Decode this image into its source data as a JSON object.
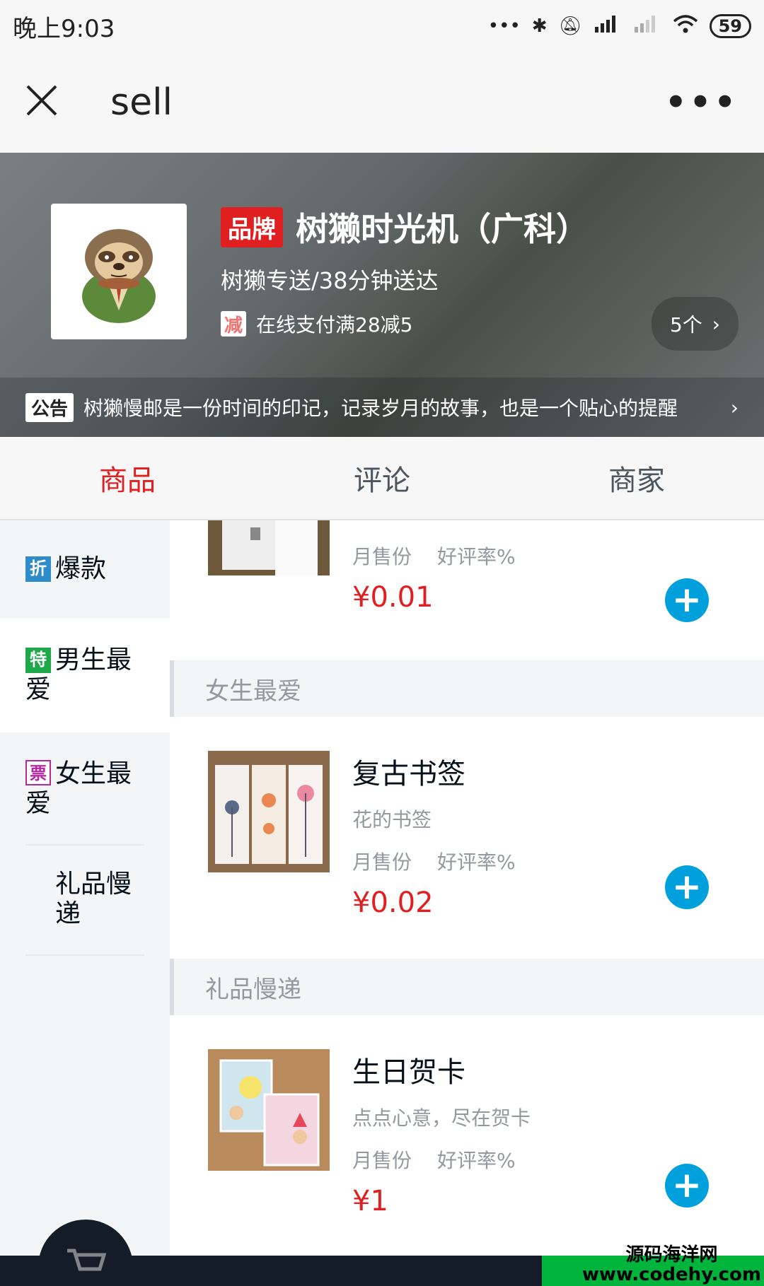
{
  "status_bar": {
    "time": "晚上9:03",
    "battery": "59"
  },
  "nav": {
    "title": "sell"
  },
  "seller": {
    "brand_tag": "品牌",
    "name": "树獭时光机（广科）",
    "description": "树獭专送/38分钟送达",
    "support_icon": "减",
    "support_text": "在线支付满28减5",
    "support_count": "5个",
    "bulletin_tag": "公告",
    "bulletin": "树獭慢邮是一份时间的印记，记录岁月的故事，也是一个贴心的提醒"
  },
  "tabs": [
    {
      "label": "商品",
      "active": true
    },
    {
      "label": "评论",
      "active": false
    },
    {
      "label": "商家",
      "active": false
    }
  ],
  "menu": [
    {
      "icon": "折",
      "icon_color": "#2e8ccb",
      "label": "爆款"
    },
    {
      "icon": "特",
      "icon_color": "#1fa84a",
      "label": "男生最爱"
    },
    {
      "icon": "票",
      "icon_color": "#b32aa0",
      "label": "女生最爱"
    },
    {
      "icon": "",
      "icon_color": "",
      "label": "礼品慢递"
    }
  ],
  "goods": {
    "partial_food": {
      "sales": "月售份",
      "rating": "好评率%",
      "price": "¥0.01"
    },
    "sections": [
      {
        "title": "女生最爱",
        "foods": [
          {
            "name": "复古书签",
            "desc": "花的书签",
            "sales": "月售份",
            "rating": "好评率%",
            "price": "¥0.02"
          }
        ]
      },
      {
        "title": "礼品慢递",
        "foods": [
          {
            "name": "生日贺卡",
            "desc": "点点心意，尽在贺卡",
            "sales": "月售份",
            "rating": "好评率%",
            "price": "¥1"
          }
        ]
      }
    ]
  },
  "watermark": {
    "line1": "源码海洋网",
    "line2": "www.codehy.com"
  },
  "colors": {
    "accent_red": "#e02020",
    "add_button_blue": "#00a0dc",
    "shopcart_dark": "#141d27",
    "pay_green": "#00b43c"
  }
}
